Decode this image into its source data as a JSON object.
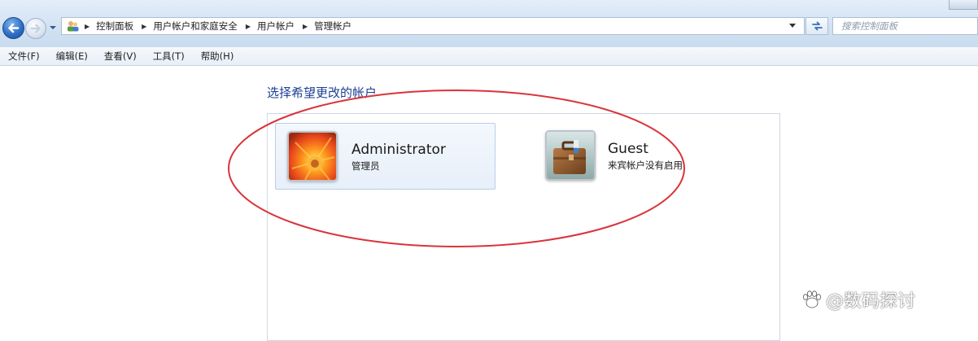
{
  "address_bar": {
    "breadcrumbs": [
      "控制面板",
      "用户帐户和家庭安全",
      "用户帐户",
      "管理帐户"
    ],
    "search_placeholder": "搜索控制面板"
  },
  "menu": [
    "文件(F)",
    "编辑(E)",
    "查看(V)",
    "工具(T)",
    "帮助(H)"
  ],
  "main": {
    "heading": "选择希望更改的帐户",
    "accounts": [
      {
        "name": "Administrator",
        "role": "管理员",
        "icon": "flower-avatar-icon",
        "selected": true
      },
      {
        "name": "Guest",
        "role": "来宾帐户没有启用",
        "icon": "briefcase-avatar-icon",
        "selected": false
      }
    ]
  },
  "annotation": {
    "color": "#d9343a"
  },
  "watermark": "@数码探讨",
  "colors": {
    "heading": "#1c3f95",
    "selection_bg": "#e7eff9",
    "selection_border": "#b9cfe8"
  }
}
